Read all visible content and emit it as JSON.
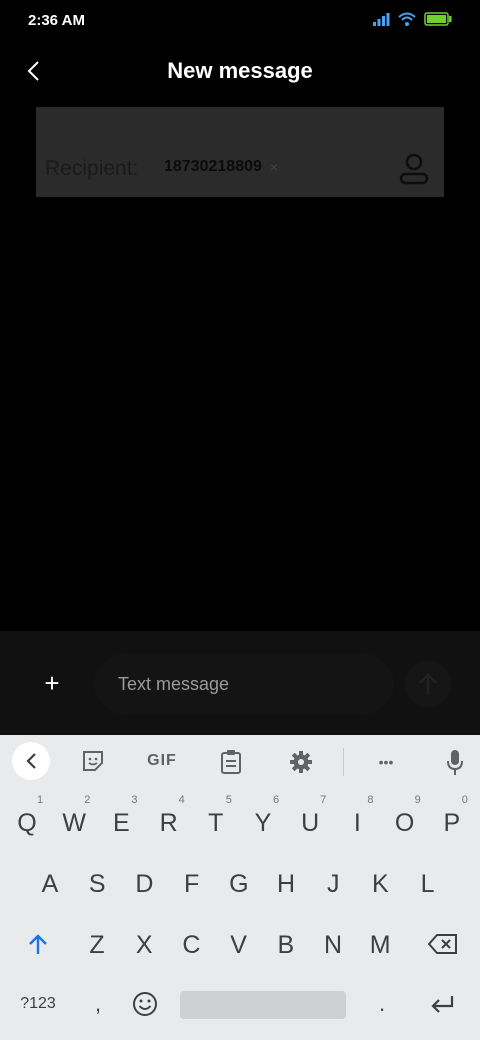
{
  "status_bar": {
    "time": "2:36 AM",
    "icons": [
      "signal-icon",
      "wifi-icon",
      "battery-icon"
    ],
    "battery_color": "#6fd22b"
  },
  "header": {
    "title": "New message",
    "back_icon": "back-arrow-icon"
  },
  "recipient": {
    "label": "Recipient:",
    "chip_number": "18730218809",
    "chip_remove": "×",
    "contact_icon": "contact-person-icon"
  },
  "compose": {
    "add_label": "+",
    "placeholder": "Text message",
    "send_icon": "send-arrow-icon"
  },
  "keyboard": {
    "toolbar": {
      "gif_label": "GIF",
      "more_label": "•••",
      "icons": [
        "collapse-icon",
        "sticker-icon",
        "clipboard-icon",
        "settings-icon",
        "mic-icon"
      ]
    },
    "row1": [
      {
        "key": "Q",
        "hint": "1"
      },
      {
        "key": "W",
        "hint": "2"
      },
      {
        "key": "E",
        "hint": "3"
      },
      {
        "key": "R",
        "hint": "4"
      },
      {
        "key": "T",
        "hint": "5"
      },
      {
        "key": "Y",
        "hint": "6"
      },
      {
        "key": "U",
        "hint": "7"
      },
      {
        "key": "I",
        "hint": "8"
      },
      {
        "key": "O",
        "hint": "9"
      },
      {
        "key": "P",
        "hint": "0"
      }
    ],
    "row2": [
      "A",
      "S",
      "D",
      "F",
      "G",
      "H",
      "J",
      "K",
      "L"
    ],
    "row3": [
      "Z",
      "X",
      "C",
      "V",
      "B",
      "N",
      "M"
    ],
    "bottom": {
      "symbols": "?123",
      "comma": ",",
      "period": "."
    },
    "accent_color": "#1a73e8"
  }
}
